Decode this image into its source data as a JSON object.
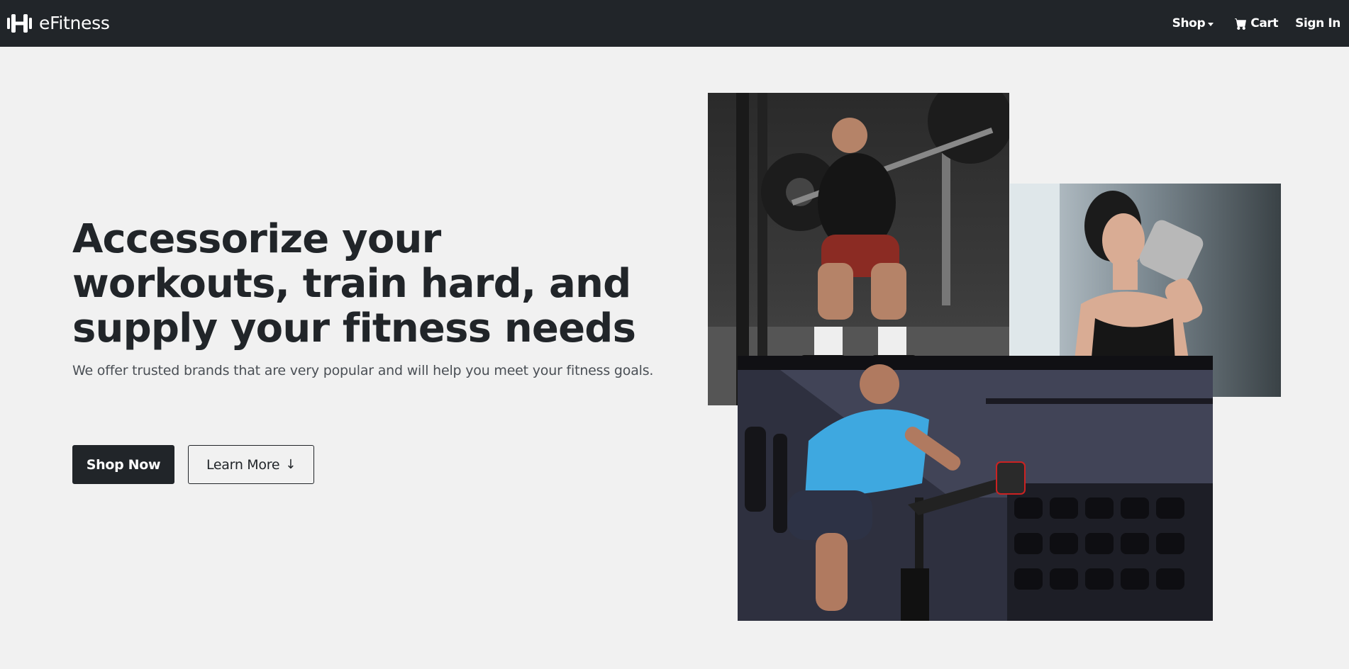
{
  "nav": {
    "brand": "eFitness",
    "brand_icon": "dumbbell-icon",
    "shop_label": "Shop",
    "cart_label": "Cart",
    "cart_icon": "cart-icon",
    "signin_label": "Sign In"
  },
  "hero": {
    "title": "Accessorize your workouts, train hard, and supply your fitness needs",
    "subtitle": "We offer trusted brands that are very popular and will help you meet your fitness goals.",
    "shop_now_label": "Shop Now",
    "learn_more_label": "Learn More",
    "learn_more_icon": "arrow-down-icon"
  },
  "colors": {
    "navbar_bg": "#212529",
    "page_bg": "#f1f1f1",
    "primary_button": "#212529"
  }
}
